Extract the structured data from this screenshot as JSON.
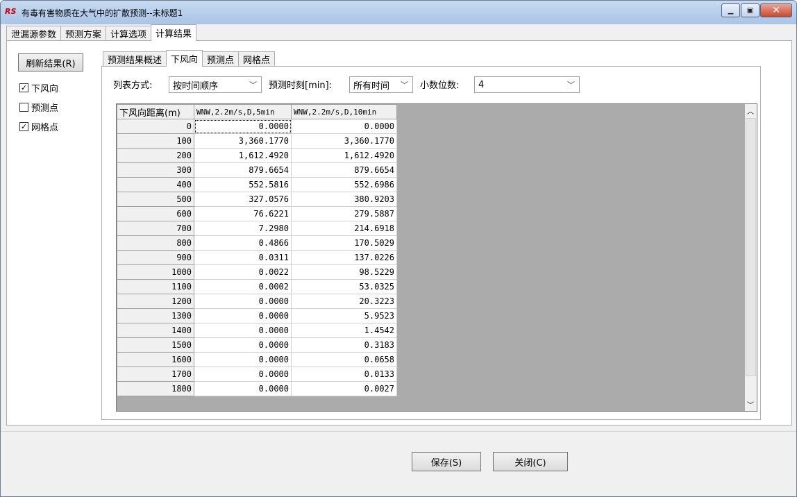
{
  "window": {
    "title": "有毒有害物质在大气中的扩散预测--未标题1",
    "icon_text": "RS"
  },
  "main_tabs": [
    "泄漏源参数",
    "预测方案",
    "计算选项",
    "计算结果"
  ],
  "sidebar": {
    "refresh_label": "刷新结果(R)",
    "checks": [
      {
        "label": "下风向",
        "checked": "✓"
      },
      {
        "label": "预测点",
        "checked": ""
      },
      {
        "label": "网格点",
        "checked": "✓"
      }
    ]
  },
  "sub_tabs": [
    "预测结果概述",
    "下风向",
    "预测点",
    "网格点"
  ],
  "toolbar": {
    "list_mode_label": "列表方式:",
    "list_mode_value": "按时间顺序",
    "time_label": "预测时刻[min]:",
    "time_value": "所有时间",
    "decimals_label": "小数位数:",
    "decimals_value": "4"
  },
  "table": {
    "headers": [
      "下风向距离(m)",
      "WNW,2.2m/s,D,5min",
      "WNW,2.2m/s,D,10min"
    ],
    "rows": [
      [
        "0",
        "0.0000",
        "0.0000"
      ],
      [
        "100",
        "3,360.1770",
        "3,360.1770"
      ],
      [
        "200",
        "1,612.4920",
        "1,612.4920"
      ],
      [
        "300",
        "879.6654",
        "879.6654"
      ],
      [
        "400",
        "552.5816",
        "552.6986"
      ],
      [
        "500",
        "327.0576",
        "380.9203"
      ],
      [
        "600",
        "76.6221",
        "279.5887"
      ],
      [
        "700",
        "7.2980",
        "214.6918"
      ],
      [
        "800",
        "0.4866",
        "170.5029"
      ],
      [
        "900",
        "0.0311",
        "137.0226"
      ],
      [
        "1000",
        "0.0022",
        "98.5229"
      ],
      [
        "1100",
        "0.0002",
        "53.0325"
      ],
      [
        "1200",
        "0.0000",
        "20.3223"
      ],
      [
        "1300",
        "0.0000",
        "5.9523"
      ],
      [
        "1400",
        "0.0000",
        "1.4542"
      ],
      [
        "1500",
        "0.0000",
        "0.3183"
      ],
      [
        "1600",
        "0.0000",
        "0.0658"
      ],
      [
        "1700",
        "0.0000",
        "0.0133"
      ],
      [
        "1800",
        "0.0000",
        "0.0027"
      ]
    ]
  },
  "buttons": {
    "save": "保存(S)",
    "close": "关闭(C)"
  },
  "icons": {
    "minimize": "minimize-icon",
    "maximize": "maximize-icon",
    "close": "close-icon"
  }
}
